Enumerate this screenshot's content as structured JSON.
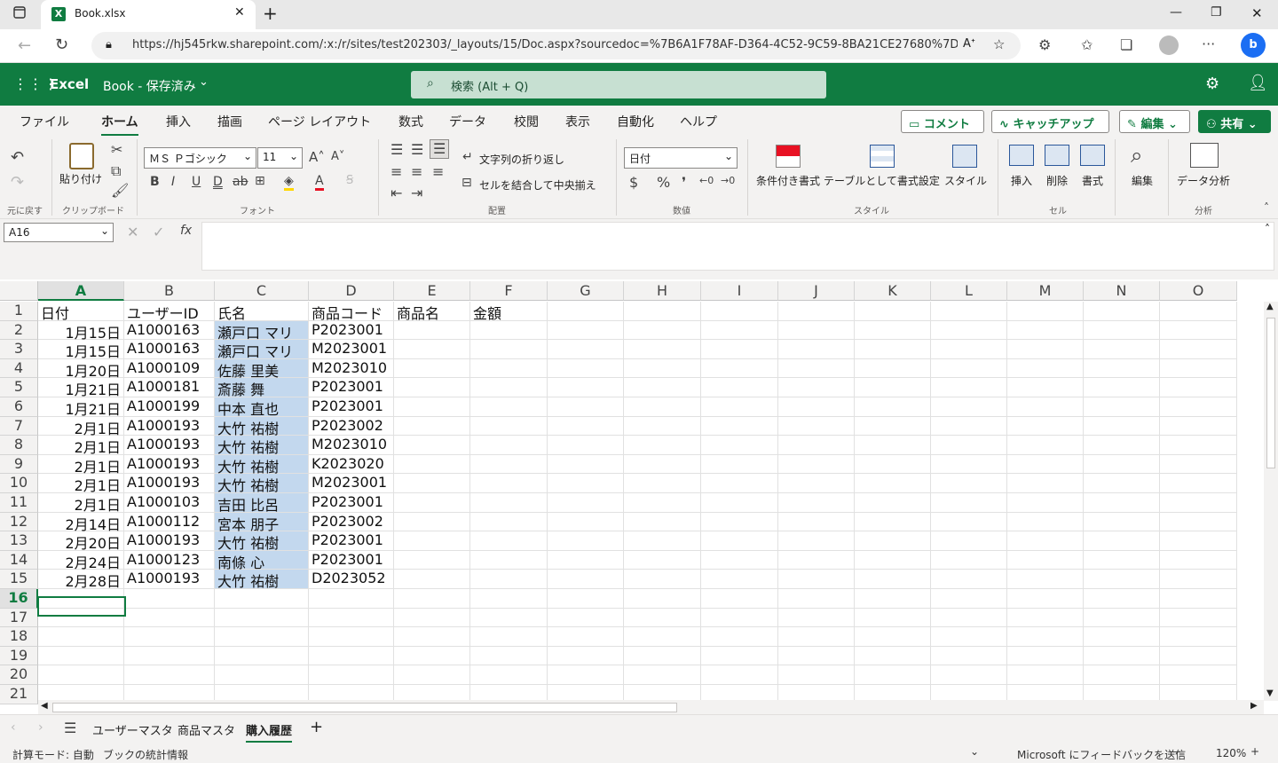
{
  "browser": {
    "tab_title": "Book.xlsx",
    "url": "https://hj545rkw.sharepoint.com/:x:/r/sites/test202303/_layouts/15/Doc.aspx?sourcedoc=%7B6A1F78AF-D364-4C52-9C59-8BA21CE27680%7D&file..."
  },
  "app": {
    "name": "Excel",
    "doc_title": "Book - 保存済み",
    "search_placeholder": "検索 (Alt + Q)",
    "brand_color": "#107c41"
  },
  "ribbon_tabs": [
    "ファイル",
    "ホーム",
    "挿入",
    "描画",
    "ページ レイアウト",
    "数式",
    "データ",
    "校閲",
    "表示",
    "自動化",
    "ヘルプ"
  ],
  "ribbon_actions": {
    "comment": "コメント",
    "catchup": "キャッチアップ",
    "edit": "編集",
    "share": "共有"
  },
  "ribbon": {
    "undo_group": "元に戻す",
    "paste": "貼り付け",
    "clipboard_group": "クリップボード",
    "font_name": "ＭＳ Ｐゴシック",
    "font_size": "11",
    "font_group": "フォント",
    "wrap_text": "文字列の折り返し",
    "merge_center": "セルを結合して中央揃え",
    "align_group": "配置",
    "number_format": "日付",
    "number_group": "数値",
    "cond_format": "条件付き書式",
    "table_format": "テーブルとして書式設定",
    "styles": "スタイル",
    "style_group": "スタイル",
    "insert": "挿入",
    "delete": "削除",
    "format": "書式",
    "cells_group": "セル",
    "editing": "編集",
    "data_analysis": "データ分析",
    "analysis_group": "分析"
  },
  "formula_bar": {
    "name_box": "A16",
    "formula": ""
  },
  "columns": [
    "A",
    "B",
    "C",
    "D",
    "E",
    "F",
    "G",
    "H",
    "I",
    "J",
    "K",
    "L",
    "M",
    "N",
    "O"
  ],
  "rows": [
    "1",
    "2",
    "3",
    "4",
    "5",
    "6",
    "7",
    "8",
    "9",
    "10",
    "11",
    "12",
    "13",
    "14",
    "15",
    "16",
    "17",
    "18",
    "19",
    "20",
    "21"
  ],
  "header_row": [
    "日付",
    "ユーザーID",
    "氏名",
    "商品コード",
    "商品名",
    "金額"
  ],
  "data_rows": [
    [
      "1月15日",
      "A1000163",
      "瀬戸口 マリ",
      "P2023001"
    ],
    [
      "1月15日",
      "A1000163",
      "瀬戸口 マリ",
      "M2023001"
    ],
    [
      "1月20日",
      "A1000109",
      "佐藤 里美",
      "M2023010"
    ],
    [
      "1月21日",
      "A1000181",
      "斎藤 舞",
      "P2023001"
    ],
    [
      "1月21日",
      "A1000199",
      "中本 直也",
      "P2023001"
    ],
    [
      "2月1日",
      "A1000193",
      "大竹 祐樹",
      "P2023002"
    ],
    [
      "2月1日",
      "A1000193",
      "大竹 祐樹",
      "M2023010"
    ],
    [
      "2月1日",
      "A1000193",
      "大竹 祐樹",
      "K2023020"
    ],
    [
      "2月1日",
      "A1000193",
      "大竹 祐樹",
      "M2023001"
    ],
    [
      "2月1日",
      "A1000103",
      "吉田 比呂",
      "P2023001"
    ],
    [
      "2月14日",
      "A1000112",
      "宮本 朋子",
      "P2023002"
    ],
    [
      "2月20日",
      "A1000193",
      "大竹 祐樹",
      "P2023001"
    ],
    [
      "2月24日",
      "A1000123",
      "南條 心",
      "P2023001"
    ],
    [
      "2月28日",
      "A1000193",
      "大竹 祐樹",
      "D2023052"
    ]
  ],
  "sheet_tabs": [
    "ユーザーマスタ",
    "商品マスタ",
    "購入履歴"
  ],
  "active_sheet": "購入履歴",
  "status": {
    "calc_mode": "計算モード: 自動",
    "stats": "ブックの統計情報",
    "feedback": "Microsoft にフィードバックを送信",
    "zoom": "120%"
  }
}
